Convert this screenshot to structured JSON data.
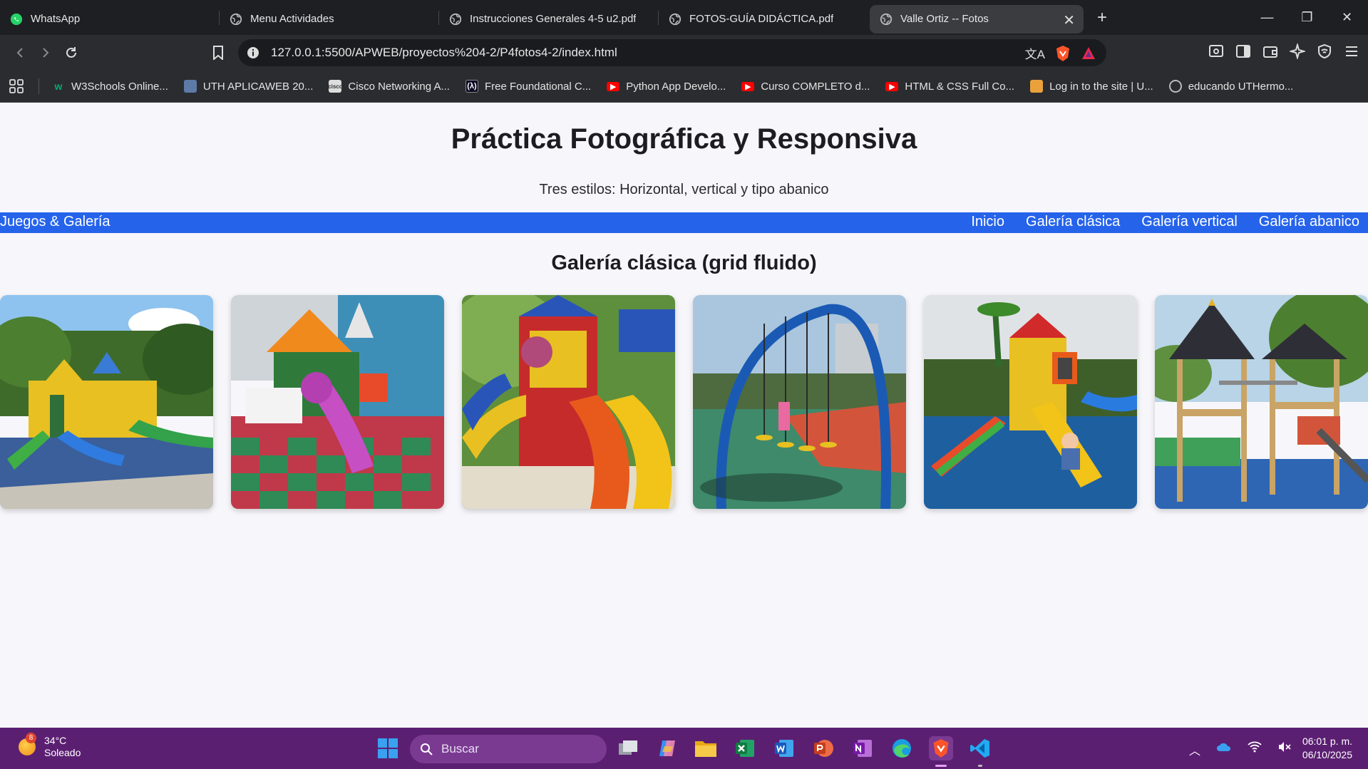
{
  "browser": {
    "tabs": [
      {
        "title": "WhatsApp",
        "icon": "whatsapp-icon"
      },
      {
        "title": "Menu Actividades",
        "icon": "globe-icon"
      },
      {
        "title": "Instrucciones Generales 4-5 u2.pdf",
        "icon": "globe-icon"
      },
      {
        "title": "FOTOS-GUÍA DIDÁCTICA.pdf",
        "icon": "globe-icon"
      },
      {
        "title": "Valle Ortiz -- Fotos",
        "icon": "globe-icon",
        "active": true
      }
    ],
    "url": "127.0.0.1:5500/APWEB/proyectos%204-2/P4fotos4-2/index.html",
    "bookmarks": [
      {
        "label": "W3Schools Online...",
        "icon": "w3schools-icon"
      },
      {
        "label": "UTH APLICAWEB 20...",
        "icon": "document-icon"
      },
      {
        "label": "Cisco Networking A...",
        "icon": "cisco-icon"
      },
      {
        "label": "Free Foundational C...",
        "icon": "freecodecamp-icon"
      },
      {
        "label": "Python App Develo...",
        "icon": "youtube-icon"
      },
      {
        "label": "Curso COMPLETO d...",
        "icon": "youtube-icon"
      },
      {
        "label": "HTML & CSS Full Co...",
        "icon": "youtube-icon"
      },
      {
        "label": "Log in to the site | U...",
        "icon": "moodle-icon"
      },
      {
        "label": "educando UTHermo...",
        "icon": "globe-icon"
      }
    ]
  },
  "page": {
    "title": "Práctica Fotográfica y Responsiva",
    "subtitle": "Tres estilos: Horizontal, vertical y tipo abanico",
    "nav": {
      "brand": "Juegos & Galería",
      "links": [
        "Inicio",
        "Galería clásica",
        "Galería vertical",
        "Galería abanico"
      ]
    },
    "section_title": "Galería clásica (grid fluido)",
    "photos": [
      {
        "name": "playground-photo-1"
      },
      {
        "name": "playground-photo-2"
      },
      {
        "name": "playground-photo-3"
      },
      {
        "name": "playground-photo-4"
      },
      {
        "name": "playground-photo-5"
      },
      {
        "name": "playground-photo-6"
      }
    ]
  },
  "taskbar": {
    "weather": {
      "temp": "34°C",
      "condition": "Soleado",
      "badge": "8"
    },
    "search_placeholder": "Buscar",
    "time": "06:01 p. m.",
    "date": "06/10/2025"
  },
  "colors": {
    "nav_bar": "#2563eb",
    "taskbar": "#5b1f72",
    "tab_bar": "#1e1f22"
  }
}
